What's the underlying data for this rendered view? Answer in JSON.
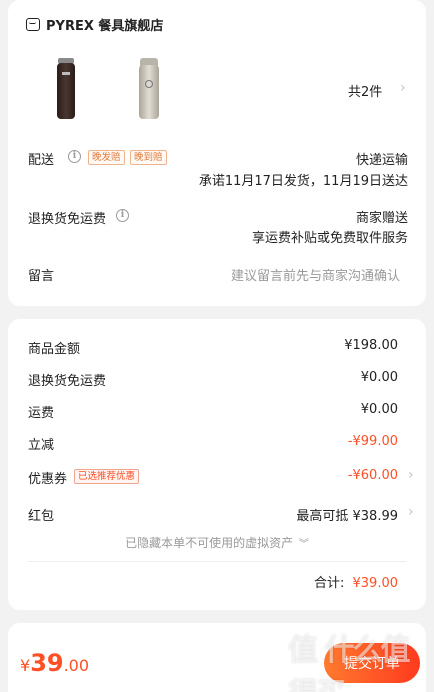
{
  "shop": {
    "name": "PYREX 餐具旗舰店",
    "icon": "store-icon"
  },
  "products": {
    "count_label": "共2件",
    "items": [
      {
        "color": "#3a2a26"
      },
      {
        "color": "#cfcac0"
      }
    ]
  },
  "delivery": {
    "label": "配送",
    "badges": [
      "晚发赔",
      "晚到赔"
    ],
    "method": "快递运输",
    "promise": "承诺11月17日发货，11月19日送达"
  },
  "return_shipping": {
    "label": "退换货免运费",
    "value": "商家赠送",
    "desc": "享运费补贴或免费取件服务"
  },
  "message": {
    "label": "留言",
    "placeholder": "建议留言前先与商家沟通确认"
  },
  "summary": {
    "rows": [
      {
        "label": "商品金额",
        "value": "¥198.00"
      },
      {
        "label": "退换货免运费",
        "value": "¥0.00"
      },
      {
        "label": "运费",
        "value": "¥0.00"
      },
      {
        "label": "立减",
        "value": "-¥99.00"
      },
      {
        "label": "优惠券",
        "badge": "已选推荐优惠",
        "value": "-¥60.00"
      },
      {
        "label": "红包",
        "value": "最高可抵 ¥38.99"
      }
    ],
    "hidden_note": "已隐藏本单不可使用的虚拟资产",
    "total_label": "合计:",
    "total_value": "¥39.00"
  },
  "footer": {
    "price_symbol": "¥",
    "price_int": "39",
    "price_dec": ".00",
    "submit_label": "提交订单",
    "watermark": "值 什么值得买"
  },
  "colors": {
    "accent": "#ff4f25",
    "badge": "#e07a3c"
  }
}
